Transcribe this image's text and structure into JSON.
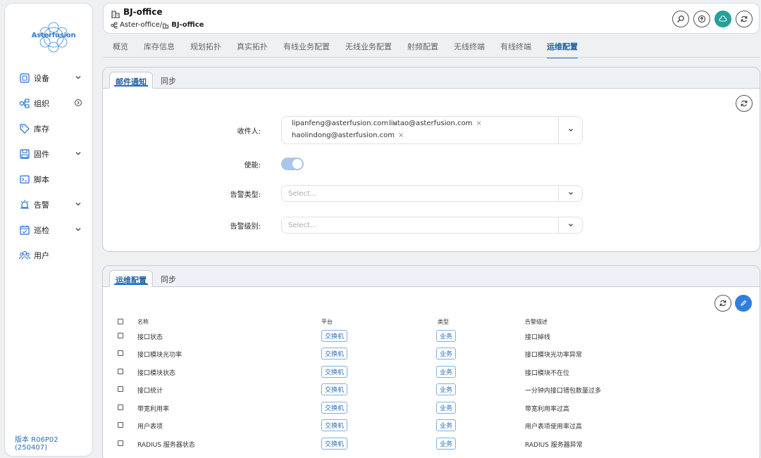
{
  "app": {
    "logo_text": "Asterfusion",
    "version": "版本 R06P02 (250407)"
  },
  "sidebar": {
    "items": [
      {
        "label": "设备",
        "icon": "device-icon",
        "has_caret": true
      },
      {
        "label": "组织",
        "icon": "org-icon",
        "has_caret": false,
        "has_circle_arrow": true
      },
      {
        "label": "库存",
        "icon": "tag-icon",
        "has_caret": false
      },
      {
        "label": "固件",
        "icon": "firmware-icon",
        "has_caret": true
      },
      {
        "label": "脚本",
        "icon": "terminal-icon",
        "has_caret": false
      },
      {
        "label": "告警",
        "icon": "alarm-icon",
        "has_caret": true
      },
      {
        "label": "巡检",
        "icon": "checklist-icon",
        "has_caret": true
      },
      {
        "label": "用户",
        "icon": "users-icon",
        "has_caret": false
      }
    ]
  },
  "header": {
    "title": "BJ-office",
    "breadcrumb_parent": "Aster-office",
    "breadcrumb_sep": " / ",
    "breadcrumb_current": "BJ-office"
  },
  "tabs": [
    "概览",
    "库存信息",
    "规划拓扑",
    "真实拓扑",
    "有线业务配置",
    "无线业务配置",
    "射频配置",
    "无线终端",
    "有线终端",
    "运维配置"
  ],
  "active_tab": "运维配置",
  "email_panel": {
    "tabs": [
      "邮件通知",
      "同步"
    ],
    "recipients_label": "收件人:",
    "recipients": [
      "lipanfeng@asterfusion.com",
      "liutao@asterfusion.com",
      "haolindong@asterfusion.com"
    ],
    "enable_label": "使能:",
    "enabled": true,
    "alarm_type_label": "告警类型:",
    "alarm_type_placeholder": "Select...",
    "alarm_level_label": "告警级别:",
    "alarm_level_placeholder": "Select..."
  },
  "ops_panel": {
    "tabs": [
      "运维配置",
      "同步"
    ],
    "columns": [
      "名称",
      "平台",
      "类型",
      "告警描述"
    ],
    "rows": [
      {
        "name": "接口状态",
        "platform": "交换机",
        "type": "业务",
        "desc": "接口掉线"
      },
      {
        "name": "接口模块光功率",
        "platform": "交换机",
        "type": "业务",
        "desc": "接口模块光功率异常"
      },
      {
        "name": "接口模块状态",
        "platform": "交换机",
        "type": "业务",
        "desc": "接口模块不在位"
      },
      {
        "name": "接口统计",
        "platform": "交换机",
        "type": "业务",
        "desc": "一分钟内接口错包数量过多"
      },
      {
        "name": "带宽利用率",
        "platform": "交换机",
        "type": "业务",
        "desc": "带宽利用率过高"
      },
      {
        "name": "用户表项",
        "platform": "交换机",
        "type": "业务",
        "desc": "用户表项使用率过高"
      },
      {
        "name": "RADIUS 服务器状态",
        "platform": "交换机",
        "type": "业务",
        "desc": "RADIUS 服务器异常"
      }
    ]
  },
  "colors": {
    "accent": "#1f6fd0",
    "teal": "#27a09a",
    "tag_border": "#7fb0df"
  }
}
